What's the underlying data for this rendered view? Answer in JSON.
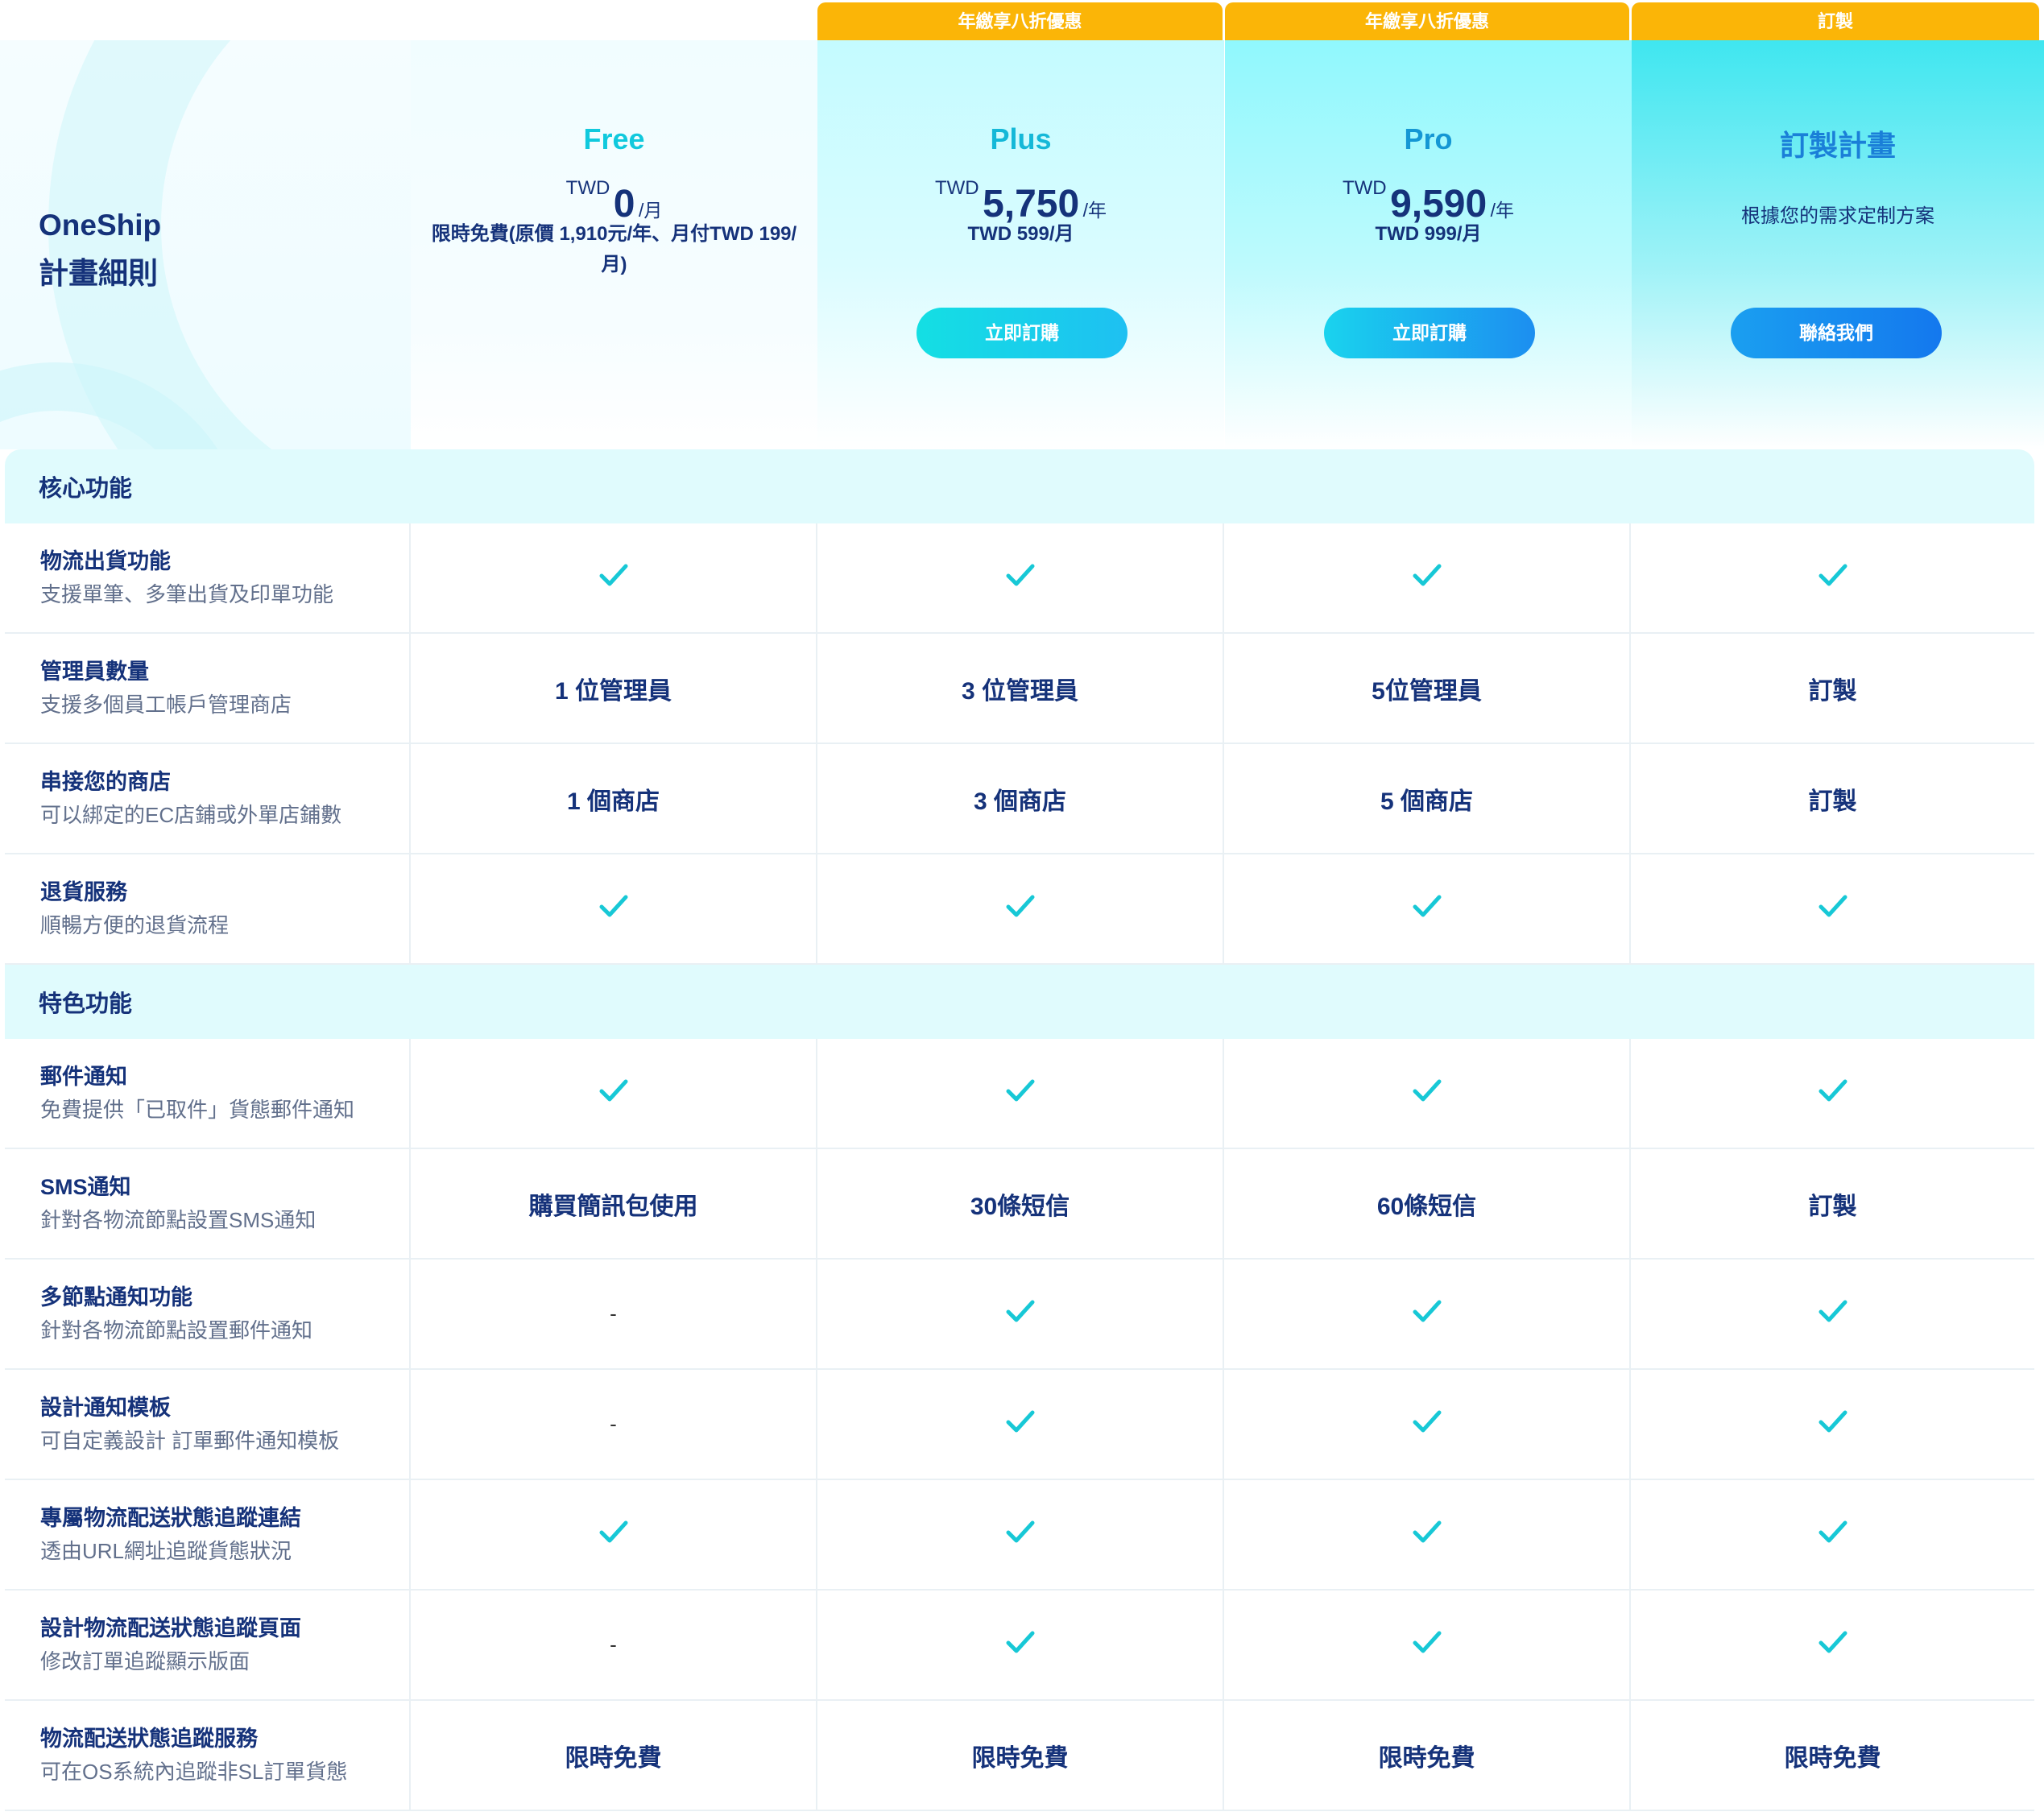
{
  "brand": {
    "line1": "OneShip",
    "line2": "計畫細則"
  },
  "plans": [
    {
      "key": "free",
      "name": "Free",
      "currency": "TWD",
      "amount": "0",
      "unit": "/月",
      "note": "限時免費(原價 1,910元/年、月付TWD 199/月)"
    },
    {
      "key": "plus",
      "tab": "年繳享八折優惠",
      "name": "Plus",
      "currency": "TWD",
      "amount": "5,750",
      "unit": "/年",
      "monthly": "TWD 599/月",
      "cta": "立即訂購"
    },
    {
      "key": "pro",
      "tab": "年繳享八折優惠",
      "name": "Pro",
      "currency": "TWD",
      "amount": "9,590",
      "unit": "/年",
      "monthly": "TWD 999/月",
      "cta": "立即訂購"
    },
    {
      "key": "custom",
      "tab": "訂製",
      "name": "訂製計畫",
      "desc": "根據您的需求定制方案",
      "cta": "聯絡我們"
    }
  ],
  "sections": [
    {
      "title": "核心功能",
      "rows": [
        {
          "title": "物流出貨功能",
          "desc": "支援單筆、多筆出貨及印單功能",
          "values": [
            "check",
            "check",
            "check",
            "check"
          ]
        },
        {
          "title": "管理員數量",
          "desc": "支援多個員工帳戶管理商店",
          "values": [
            "1 位管理員",
            "3 位管理員",
            "5位管理員",
            "訂製"
          ]
        },
        {
          "title": "串接您的商店",
          "desc": "可以綁定的EC店鋪或外單店鋪數",
          "values": [
            "1 個商店",
            "3 個商店",
            "5 個商店",
            "訂製"
          ]
        },
        {
          "title": "退貨服務",
          "desc": "順暢方便的退貨流程",
          "values": [
            "check",
            "check",
            "check",
            "check"
          ]
        }
      ]
    },
    {
      "title": "特色功能",
      "rows": [
        {
          "title": "郵件通知",
          "desc": "免費提供「已取件」貨態郵件通知",
          "values": [
            "check",
            "check",
            "check",
            "check"
          ]
        },
        {
          "title": "SMS通知",
          "desc": "針對各物流節點設置SMS通知",
          "values": [
            "購買簡訊包使用",
            "30條短信",
            "60條短信",
            "訂製"
          ]
        },
        {
          "title": "多節點通知功能",
          "desc": "針對各物流節點設置郵件通知",
          "values": [
            "-",
            "check",
            "check",
            "check"
          ]
        },
        {
          "title": "設計通知模板",
          "desc": "可自定義設計 訂單郵件通知模板",
          "values": [
            "-",
            "check",
            "check",
            "check"
          ]
        },
        {
          "title": "專屬物流配送狀態追蹤連結",
          "desc": "透由URL網址追蹤貨態狀況",
          "values": [
            "check",
            "check",
            "check",
            "check"
          ]
        },
        {
          "title": "設計物流配送狀態追蹤頁面",
          "desc": "修改訂單追蹤顯示版面",
          "values": [
            "-",
            "check",
            "check",
            "check"
          ]
        },
        {
          "title": "物流配送狀態追蹤服務",
          "desc": "可在OS系統內追蹤非SL訂單貨態",
          "values": [
            "限時免費",
            "限時免費",
            "限時免費",
            "限時免費"
          ]
        }
      ]
    }
  ],
  "icons": {
    "check": "check-icon"
  },
  "colors": {
    "accent": "#10c9dd",
    "tab": "#fbb507",
    "text": "#15327a",
    "check": "#17c8d6",
    "section_bg": "#e0fbfd"
  }
}
